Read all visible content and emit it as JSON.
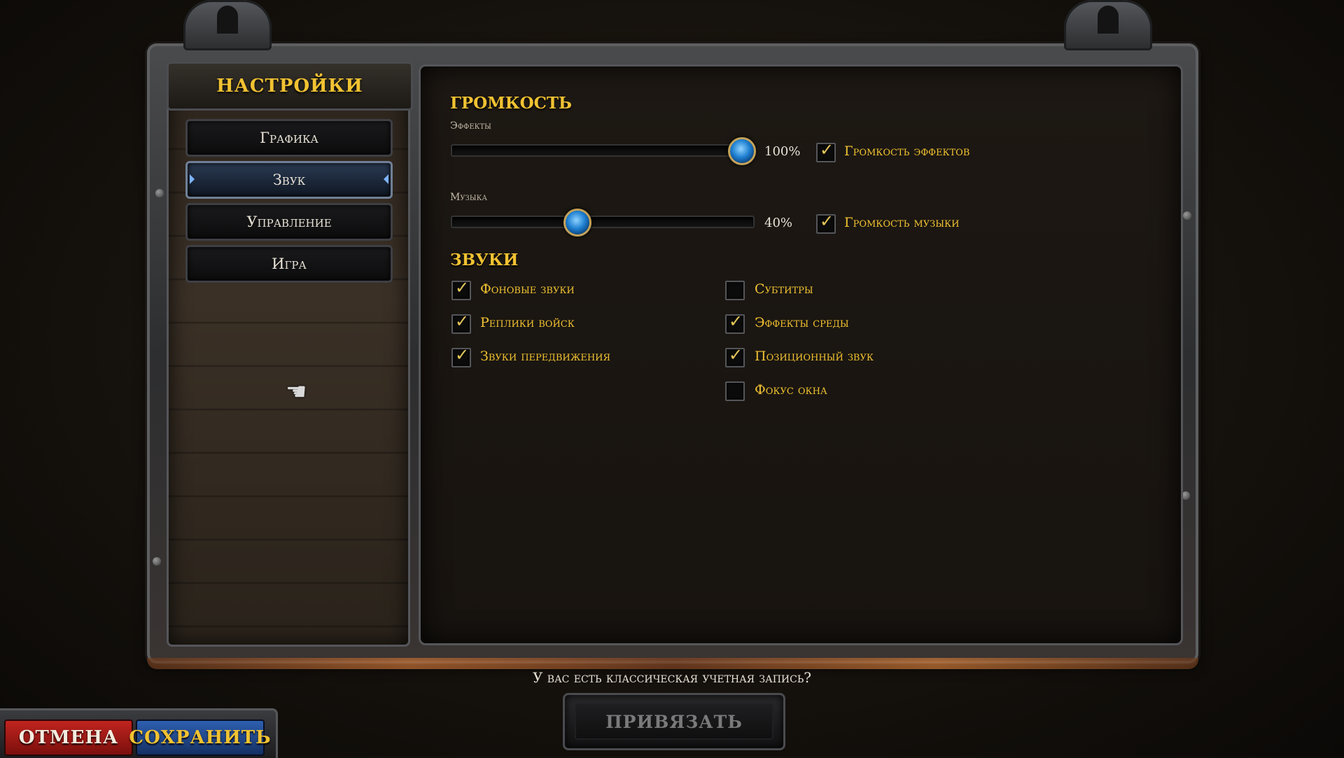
{
  "sidebar": {
    "title": "НАСТРОЙКИ",
    "items": [
      {
        "label": "Графика",
        "active": false
      },
      {
        "label": "Звук",
        "active": true
      },
      {
        "label": "Управление",
        "active": false
      },
      {
        "label": "Игра",
        "active": false
      }
    ]
  },
  "volume": {
    "section_title": "ГРОМКОСТЬ",
    "effects": {
      "label": "Эффекты",
      "value_text": "100%",
      "value": 1.0,
      "toggle_label": "Громкость эффектов",
      "toggle_checked": true
    },
    "music": {
      "label": "Музыка",
      "value_text": "40%",
      "value": 0.4,
      "toggle_label": "Громкость музыки",
      "toggle_checked": true
    }
  },
  "sounds": {
    "section_title": "ЗВУКИ",
    "left": [
      {
        "label": "Фоновые звуки",
        "checked": true
      },
      {
        "label": "Реплики войск",
        "checked": true
      },
      {
        "label": "Звуки передвижения",
        "checked": true
      }
    ],
    "right": [
      {
        "label": "Субтитры",
        "checked": false
      },
      {
        "label": "Эффекты среды",
        "checked": true
      },
      {
        "label": "Позиционный звук",
        "checked": true
      },
      {
        "label": "Фокус окна",
        "checked": false
      }
    ]
  },
  "account": {
    "question": "У вас есть классическая учетная запись?",
    "link_label": "ПРИВЯЗАТЬ"
  },
  "footer": {
    "cancel_label": "ОТМЕНА",
    "save_label": "СОХРАНИТЬ"
  },
  "colors": {
    "accent_gold": "#f1c232",
    "cancel_red": "#c0241f",
    "save_blue": "#2e5fb0",
    "knob_blue": "#1e7fd0"
  },
  "icons": {
    "cursor": "gauntlet-pointer-icon",
    "checkbox_mark": "checkmark-icon"
  }
}
